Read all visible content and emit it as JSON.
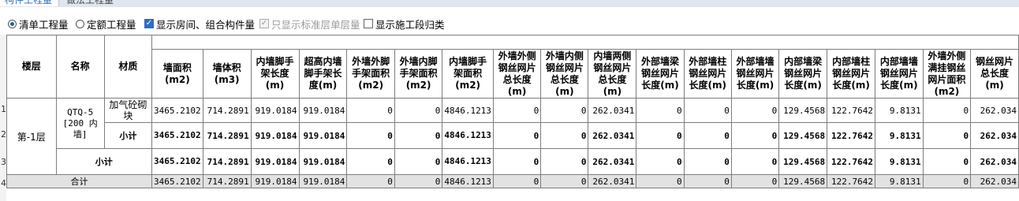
{
  "tabs": [
    "构件工程量",
    "做法工程量"
  ],
  "options": {
    "radio_qingdan": "清单工程量",
    "radio_dinge": "定额工程量",
    "chk_room": "显示房间、组合构件量",
    "chk_std": "只显示标准层单层量",
    "chk_section": "显示施工段归类"
  },
  "columns": {
    "floor": "楼层",
    "name": "名称",
    "material": "材质",
    "c1": "墙面积(m2)",
    "c2": "墙体积(m3)",
    "c3": "内墙脚手架长度(m)",
    "c4": "超高内墙脚手架长度(m)",
    "c5": "外墙外脚手架面积(m2)",
    "c6": "外墙内脚手架面积(m2)",
    "c7": "内墙脚手架面积(m2)",
    "c8": "外墙外侧钢丝网片总长度(m)",
    "c9": "外墙内侧钢丝网片总长度(m)",
    "c10": "内墙两侧钢丝网片总长度(m)",
    "c11": "外部墙梁钢丝网片长度(m)",
    "c12": "外部墙柱钢丝网片长度(m)",
    "c13": "外部墙墙钢丝网片长度(m)",
    "c14": "内部墙梁钢丝网片长度(m)",
    "c15": "内部墙柱钢丝网片长度(m)",
    "c16": "内部墙墙钢丝网片长度(m)",
    "c17": "外墙外侧满挂钢丝网片面积(m2)",
    "c18": "钢丝网片总长度(m)"
  },
  "rownums": [
    "1",
    "2",
    "3",
    "4"
  ],
  "labels": {
    "floor": "第-1层",
    "name": "QTQ-5 [200 内墙]",
    "material": "加气砼砌块",
    "subtotal": "小计",
    "total": "合计"
  },
  "row1": [
    "3465.2102",
    "714.2891",
    "919.0184",
    "919.0184",
    "0",
    "0",
    "4846.1213",
    "0",
    "0",
    "262.0341",
    "0",
    "0",
    "0",
    "129.4568",
    "122.7642",
    "9.8131",
    "0",
    "262.034"
  ],
  "row2": [
    "3465.2102",
    "714.2891",
    "919.0184",
    "919.0184",
    "0",
    "0",
    "4846.1213",
    "0",
    "0",
    "262.0341",
    "0",
    "0",
    "0",
    "129.4568",
    "122.7642",
    "9.8131",
    "0",
    "262.034"
  ],
  "row3": [
    "3465.2102",
    "714.2891",
    "919.0184",
    "919.0184",
    "0",
    "0",
    "4846.1213",
    "0",
    "0",
    "262.0341",
    "0",
    "0",
    "0",
    "129.4568",
    "122.7642",
    "9.8131",
    "0",
    "262.034"
  ],
  "row4": [
    "3465.2102",
    "714.2891",
    "919.0184",
    "919.0184",
    "0",
    "0",
    "4846.1213",
    "0",
    "0",
    "262.0341",
    "0",
    "0",
    "0",
    "129.4568",
    "122.7642",
    "9.8131",
    "0",
    "262.034"
  ]
}
